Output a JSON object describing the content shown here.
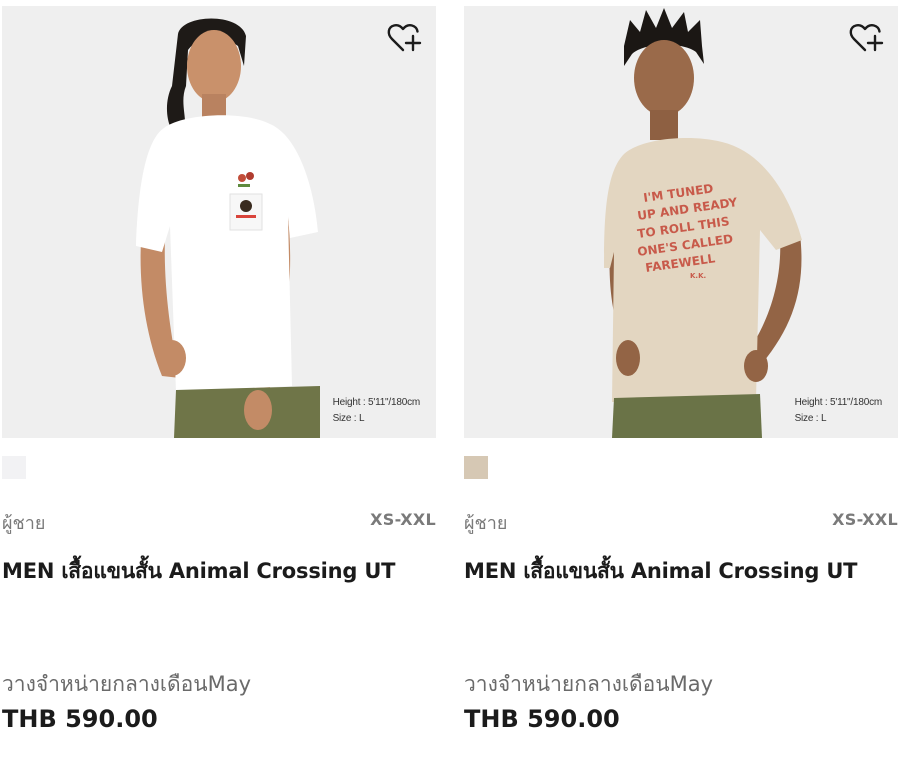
{
  "products": [
    {
      "image_bg": "#efefef",
      "shirt_color": "#ffffff",
      "swatch_color": "#f2f2f4",
      "pants_color": "#6f7548",
      "model_height": "Height : 5'11\"/180cm",
      "model_size": "Size : L",
      "gender": "ผู้ชาย",
      "sizes": "XS-XXL",
      "title": "MEN เสื้อแขนสั้น Animal Crossing UT",
      "release": "วางจำหน่ายกลางเดือนMay",
      "price": "THB 590.00",
      "wishlist_icon": "heart-plus-icon"
    },
    {
      "image_bg": "#efefef",
      "shirt_color": "#e3d6c1",
      "swatch_color": "#d6c8b4",
      "pants_color": "#6a7347",
      "model_height": "Height : 5'11\"/180cm",
      "model_size": "Size : L",
      "gender": "ผู้ชาย",
      "sizes": "XS-XXL",
      "title": "MEN เสื้อแขนสั้น Animal Crossing UT",
      "release": "วางจำหน่ายกลางเดือนMay",
      "price": "THB 590.00",
      "wishlist_icon": "heart-plus-icon",
      "shirt_print": [
        "I'M TUNED",
        "UP AND READY",
        "TO ROLL THIS",
        "ONE'S CALLED",
        "FAREWELL",
        "K.K."
      ]
    }
  ]
}
